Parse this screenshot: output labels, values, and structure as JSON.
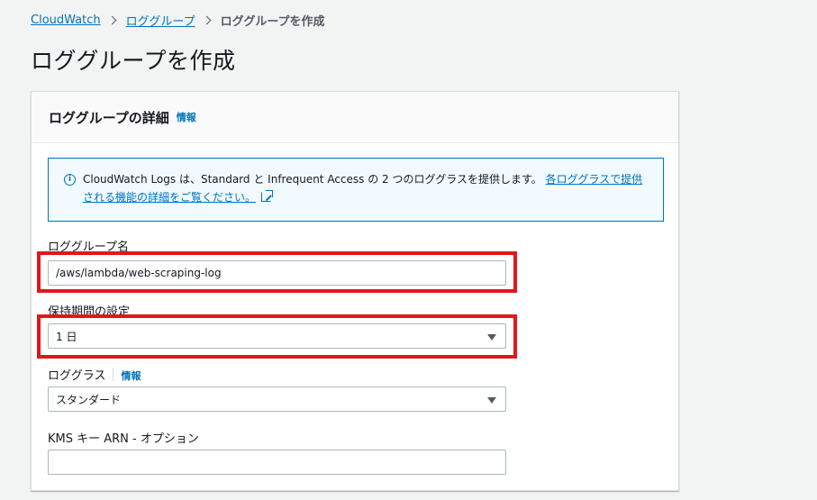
{
  "breadcrumb": {
    "items": [
      "CloudWatch",
      "ロググループ"
    ],
    "current": "ロググループを作成"
  },
  "page": {
    "title": "ロググループを作成"
  },
  "panel": {
    "title": "ロググループの詳細",
    "info_label": "情報"
  },
  "alert": {
    "text": "CloudWatch Logs は、Standard と Infrequent Access の 2 つのロググラスを提供します。",
    "link_text_line1": "各ロググラスで提供",
    "link_text_line2": "される機能の詳細をご覧ください。"
  },
  "form": {
    "log_group_name": {
      "label": "ロググループ名",
      "value": "/aws/lambda/web-scraping-log"
    },
    "retention": {
      "label": "保持期間の設定",
      "value": "1 日"
    },
    "log_class": {
      "label": "ロググラス",
      "info_label": "情報",
      "value": "スタンダード"
    },
    "kms": {
      "label": "KMS キー ARN - オプション",
      "value": ""
    }
  },
  "colors": {
    "accent": "#0073bb",
    "highlight": "#e3161b",
    "background": "#f2f3f3"
  }
}
